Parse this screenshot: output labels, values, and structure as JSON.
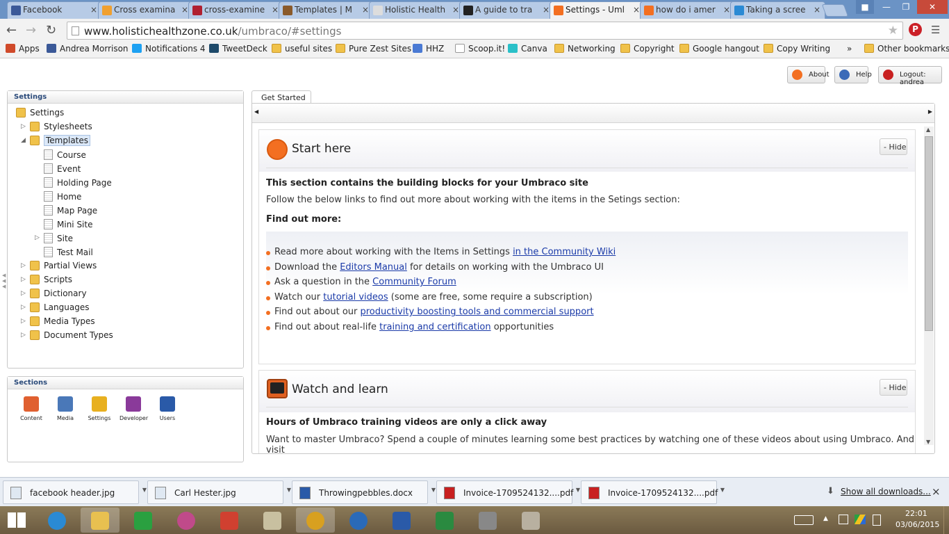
{
  "browser": {
    "tabs": [
      {
        "title": "Facebook",
        "color": "#3b5998"
      },
      {
        "title": "Cross examina",
        "color": "#f0a030"
      },
      {
        "title": "cross-examine",
        "color": "#b02030"
      },
      {
        "title": "Templates | M",
        "color": "#8a5a2a"
      },
      {
        "title": "Holistic Health",
        "color": "#dddddd"
      },
      {
        "title": "A guide to tra",
        "color": "#222222"
      },
      {
        "title": "Settings - Uml",
        "color": "#f36f21"
      },
      {
        "title": "how do i amer",
        "color": "#f36f21"
      },
      {
        "title": "Taking a scree",
        "color": "#2a8ad4"
      }
    ],
    "tab_close": "×",
    "url_domain": "www.holistichealthzone.co.uk",
    "url_path": "/umbraco/#settings",
    "bookmarks": [
      {
        "label": "Apps",
        "icon": "apps-icon"
      },
      {
        "label": "Andrea Morrison",
        "icon": "facebook-icon"
      },
      {
        "label": "Notifications 4",
        "icon": "twitter-icon"
      },
      {
        "label": "TweetDeck",
        "icon": "tweetdeck-icon"
      },
      {
        "label": "useful sites",
        "icon": "folder-icon"
      },
      {
        "label": "Pure Zest Sites",
        "icon": "folder-icon"
      },
      {
        "label": "HHZ",
        "icon": "google-icon"
      },
      {
        "label": "Scoop.it!",
        "icon": "page-icon"
      },
      {
        "label": "Canva",
        "icon": "canva-icon"
      },
      {
        "label": "Networking",
        "icon": "folder-icon"
      },
      {
        "label": "Copyright",
        "icon": "folder-icon"
      },
      {
        "label": "Google hangout",
        "icon": "folder-icon"
      },
      {
        "label": "Copy Writing",
        "icon": "folder-icon"
      }
    ],
    "more_chevron": "»",
    "other_bookmarks": "Other bookmarks"
  },
  "header": {
    "about": "About",
    "help": "Help",
    "logout": "Logout: andrea"
  },
  "tree": {
    "panel_title": "Settings",
    "root": "Settings",
    "items": [
      {
        "label": "Stylesheets",
        "type": "folder",
        "level": 1,
        "expander": "closed"
      },
      {
        "label": "Templates",
        "type": "folder",
        "level": 1,
        "expander": "open",
        "selected": true
      },
      {
        "label": "Course",
        "type": "page",
        "level": 2
      },
      {
        "label": "Event",
        "type": "page",
        "level": 2
      },
      {
        "label": "Holding Page",
        "type": "page",
        "level": 2
      },
      {
        "label": "Home",
        "type": "page",
        "level": 2
      },
      {
        "label": "Map Page",
        "type": "page",
        "level": 2
      },
      {
        "label": "Mini Site",
        "type": "page",
        "level": 2
      },
      {
        "label": "Site",
        "type": "page",
        "level": 2,
        "expander": "closed"
      },
      {
        "label": "Test Mail",
        "type": "page",
        "level": 2
      },
      {
        "label": "Partial Views",
        "type": "folder",
        "level": 1,
        "expander": "closed"
      },
      {
        "label": "Scripts",
        "type": "folder",
        "level": 1,
        "expander": "closed"
      },
      {
        "label": "Dictionary",
        "type": "folder",
        "level": 1,
        "expander": "closed"
      },
      {
        "label": "Languages",
        "type": "folder",
        "level": 1,
        "expander": "closed"
      },
      {
        "label": "Media Types",
        "type": "folder",
        "level": 1,
        "expander": "closed"
      },
      {
        "label": "Document Types",
        "type": "folder",
        "level": 1,
        "expander": "closed"
      }
    ]
  },
  "sections": {
    "panel_title": "Sections",
    "items": [
      {
        "label": "Content",
        "icon": "content-icon",
        "color": "#e06030"
      },
      {
        "label": "Media",
        "icon": "media-icon",
        "color": "#4a78b8"
      },
      {
        "label": "Settings",
        "icon": "settings-icon",
        "color": "#e8b020"
      },
      {
        "label": "Developer",
        "icon": "developer-icon",
        "color": "#8a3a9a"
      },
      {
        "label": "Users",
        "icon": "users-icon",
        "color": "#2a5aa8"
      }
    ]
  },
  "content": {
    "tab": "Get Started",
    "start": {
      "title": "Start here",
      "hide": "- Hide",
      "heading": "This section contains the building blocks for your Umbraco site",
      "intro": "Follow the below links to find out more about working with the items in the Setings section:",
      "find_more": "Find out more:",
      "bullets": [
        {
          "pre": "Read more about working with the Items in Settings ",
          "link": "in the Community Wiki",
          "post": ""
        },
        {
          "pre": "Download the ",
          "link": "Editors Manual",
          "post": " for details on working with the Umbraco UI"
        },
        {
          "pre": "Ask a question in the ",
          "link": "Community Forum",
          "post": ""
        },
        {
          "pre": "Watch our ",
          "link": "tutorial videos",
          "post": " (some are free, some require a subscription)"
        },
        {
          "pre": "Find out about our ",
          "link": "productivity boosting tools and commercial support",
          "post": ""
        },
        {
          "pre": "Find out about real-life ",
          "link": "training and certification",
          "post": " opportunities"
        }
      ]
    },
    "watch": {
      "title": "Watch and learn",
      "hide": "- Hide",
      "heading": "Hours of Umbraco training videos are only a click away",
      "intro": "Want to master Umbraco? Spend a couple of minutes learning some best practices by watching one of these videos about using Umbraco. And visit"
    }
  },
  "downloads": {
    "items": [
      {
        "label": "facebook  header.jpg",
        "icon": "image-icon"
      },
      {
        "label": "Carl Hester.jpg",
        "icon": "image-icon"
      },
      {
        "label": "Throwingpebbles.docx",
        "icon": "word-icon"
      },
      {
        "label": "Invoice-1709524132....pdf",
        "icon": "pdf-icon"
      },
      {
        "label": "Invoice-1709524132....pdf",
        "icon": "pdf-icon"
      }
    ],
    "show_all": "Show all downloads...",
    "close": "×"
  },
  "taskbar": {
    "apps": [
      {
        "icon": "ie-icon",
        "color": "#2a8ad4"
      },
      {
        "icon": "explorer-icon",
        "color": "#e8c050"
      },
      {
        "icon": "store-icon",
        "color": "#2aa040"
      },
      {
        "icon": "picasa-icon",
        "color": "#c04a8a"
      },
      {
        "icon": "apps-grid-icon",
        "color": "#d04030"
      },
      {
        "icon": "notes-icon",
        "color": "#c8c0a0"
      },
      {
        "icon": "chrome-icon",
        "color": "#d8a020"
      },
      {
        "icon": "browser-icon",
        "color": "#2a6ab8"
      },
      {
        "icon": "word-icon",
        "color": "#2a5aa8"
      },
      {
        "icon": "excel-icon",
        "color": "#2a8a40"
      },
      {
        "icon": "printer-icon",
        "color": "#888888"
      },
      {
        "icon": "paint-icon",
        "color": "#b8b0a0"
      }
    ],
    "time": "22:01",
    "date": "03/06/2015"
  }
}
